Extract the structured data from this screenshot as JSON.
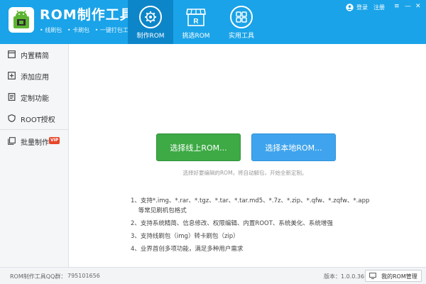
{
  "header": {
    "app_title": "ROM制作工具",
    "subtitle_items": [
      "• 线刷包",
      "• 卡刷包",
      "• 一键打包工具"
    ],
    "nav_tabs": [
      {
        "label": "制作ROM",
        "icon": "gear-icon",
        "active": true
      },
      {
        "label": "挑选ROM",
        "icon": "store-icon",
        "active": false
      },
      {
        "label": "实用工具",
        "icon": "grid-icon",
        "active": false
      }
    ],
    "user_links": {
      "login": "登录",
      "register": "注册"
    }
  },
  "sidebar": {
    "items": [
      {
        "label": "内置精简",
        "icon": "window-icon"
      },
      {
        "label": "添加应用",
        "icon": "add-square-icon"
      },
      {
        "label": "定制功能",
        "icon": "document-icon"
      },
      {
        "label": "ROOT授权",
        "icon": "shield-icon"
      },
      {
        "label": "批量制作",
        "icon": "batch-icon",
        "badge": "VIP"
      }
    ]
  },
  "main": {
    "btn_online": "选择线上ROM...",
    "btn_local": "选择本地ROM...",
    "hint": "选择好要编辑的ROM，将自动解包，开始全新定制。",
    "features": [
      "1、支持*.img、*.rar、*.tgz、*.tar、*.tar.md5、*.7z、*.zip、*.qfw、*.zqfw、*.app",
      "    等常见刷机包格式",
      "2、支持系统精简、信息修改、权限编辑、内置ROOT、系统美化、系统增强",
      "3、支持线刷包（img）转卡刷包（zip）",
      "4、业界首创多项功能，满足多种用户需求"
    ]
  },
  "footer": {
    "qq_label": "ROM制作工具QQ群：",
    "qq_number": "795101656",
    "version": "版本：1.0.0.36",
    "rom_manager": "我的ROM管理"
  },
  "colors": {
    "header_blue": "#1aa3e8",
    "active_tab": "#0d86c9",
    "green_button": "#3daa45",
    "blue_button": "#3fa4ed",
    "vip_badge": "#e8462b"
  }
}
